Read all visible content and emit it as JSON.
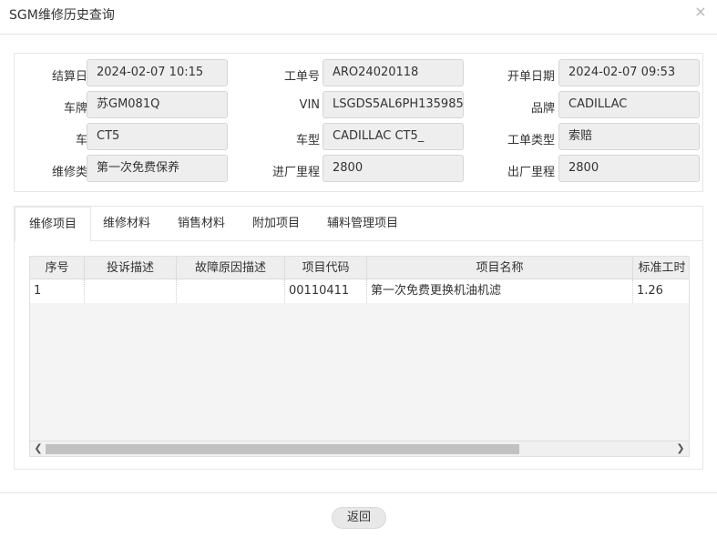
{
  "window": {
    "title": "SGM维修历史查询",
    "close_icon": "close-icon"
  },
  "info": {
    "row1": [
      {
        "label": "结算日期",
        "value": "2024-02-07 10:15"
      },
      {
        "label": "工单号",
        "value": "ARO24020118"
      },
      {
        "label": "开单日期",
        "value": "2024-02-07 09:53"
      }
    ],
    "row2": [
      {
        "label": "车牌号",
        "value": "苏GM081Q"
      },
      {
        "label": "VIN",
        "value": "LSGDS5AL6PH135985"
      },
      {
        "label": "品牌",
        "value": "CADILLAC"
      }
    ],
    "row3": [
      {
        "label": "车系",
        "value": "CT5"
      },
      {
        "label": "车型",
        "value": "CADILLAC CT5_"
      },
      {
        "label": "工单类型",
        "value": "索赔"
      }
    ],
    "row4": [
      {
        "label": "维修类型",
        "value": "第一次免费保养"
      },
      {
        "label": "进厂里程",
        "value": "2800"
      },
      {
        "label": "出厂里程",
        "value": "2800"
      }
    ]
  },
  "tabs": [
    "维修项目",
    "维修材料",
    "销售材料",
    "附加项目",
    "辅料管理项目"
  ],
  "active_tab": "维修项目",
  "grid": {
    "columns": [
      "序号",
      "投诉描述",
      "故障原因描述",
      "项目代码",
      "项目名称",
      "标准工时"
    ],
    "rows": [
      [
        "1",
        "",
        "",
        "00110411",
        "第一次免费更换机油机滤",
        "1.26"
      ]
    ]
  },
  "footer": {
    "back_label": "返回"
  }
}
